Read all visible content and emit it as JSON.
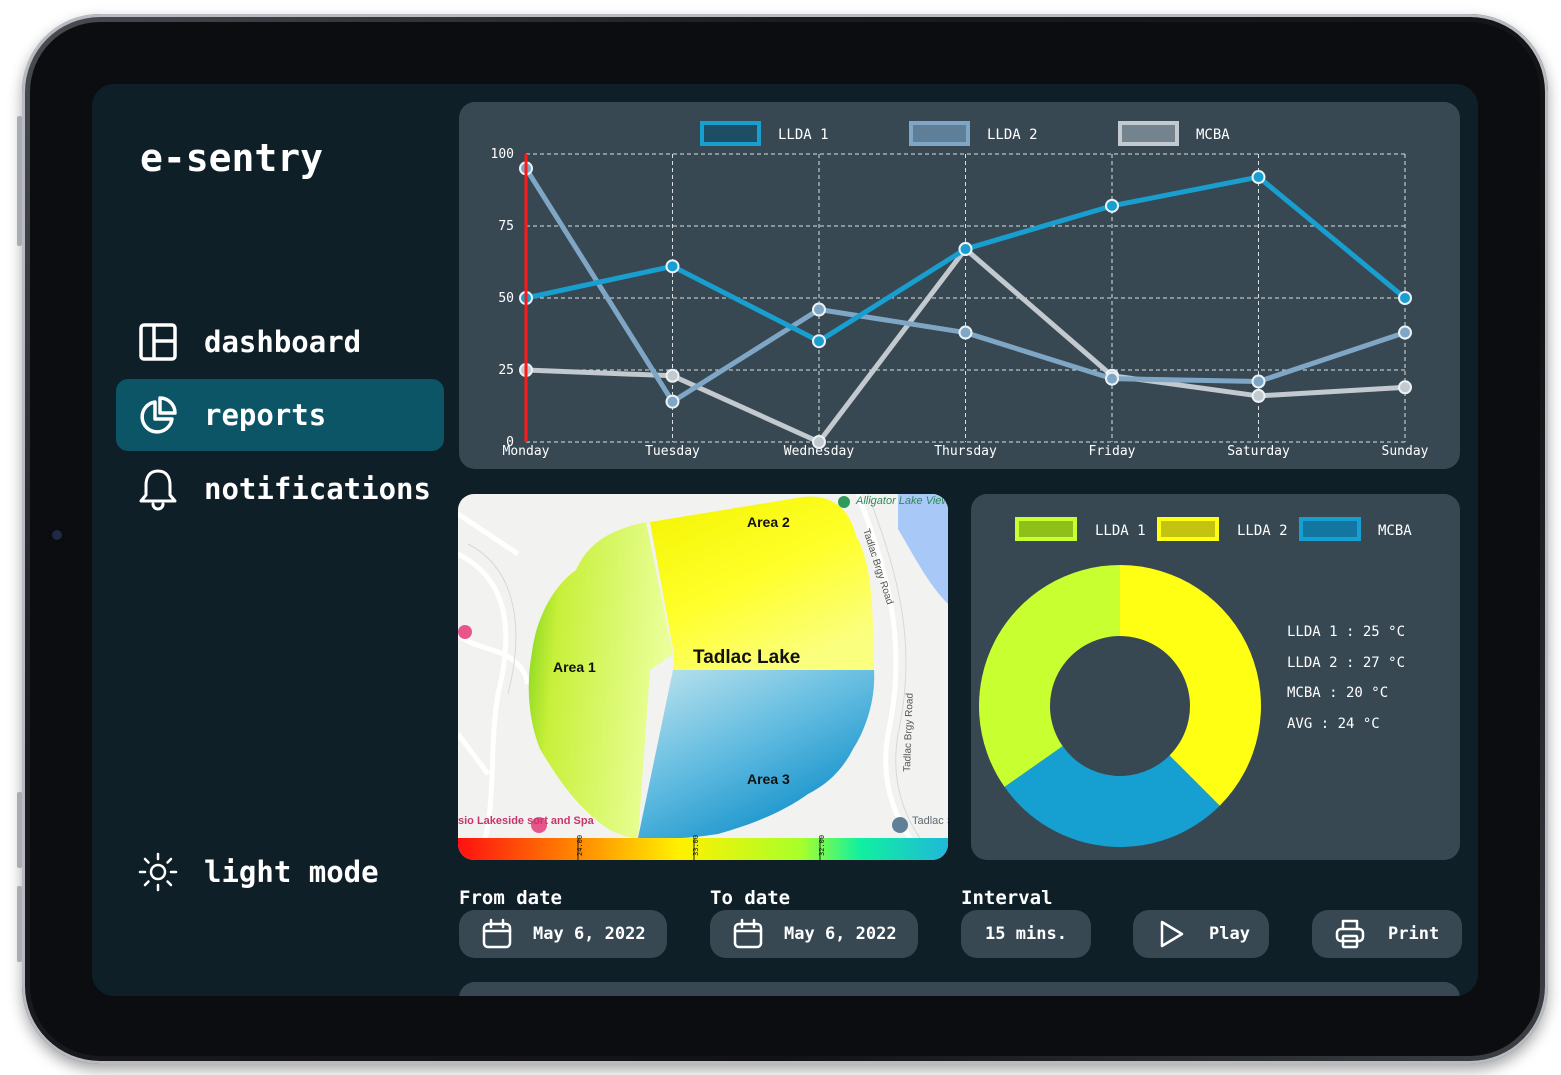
{
  "app": {
    "brand": "e-sentry"
  },
  "nav": {
    "items": [
      {
        "label": "dashboard",
        "icon": "layout-icon",
        "active": false
      },
      {
        "label": "reports",
        "icon": "pie-chart-icon",
        "active": true
      },
      {
        "label": "notifications",
        "icon": "bell-icon",
        "active": false
      }
    ],
    "theme_toggle": {
      "label": "light mode",
      "icon": "sun-icon"
    }
  },
  "colors": {
    "llda1": "#189fd0",
    "llda2": "#7fa7c5",
    "mcba": "#c2c9cf",
    "donut_llda1": "#c8ff30",
    "donut_llda2": "#ffff14",
    "donut_mcba": "#16a0d1",
    "cursor": "#ff1a1a",
    "active_nav": "#0b5566",
    "panel": "#374853",
    "background": "#0f1f28"
  },
  "chart_data": [
    {
      "type": "line",
      "x": [
        "Monday",
        "Tuesday",
        "Wednesday",
        "Thursday",
        "Friday",
        "Saturday",
        "Sunday"
      ],
      "ylim": [
        0,
        100
      ],
      "yticks": [
        "0",
        "25",
        "50",
        "75",
        "100"
      ],
      "grid": true,
      "legend_position": "top-center",
      "series": [
        {
          "name": "LLDA 1",
          "values": [
            50,
            61,
            35,
            67,
            82,
            92,
            50
          ]
        },
        {
          "name": "LLDA 2",
          "values": [
            95,
            14,
            46,
            38,
            22,
            21,
            38
          ]
        },
        {
          "name": "MCBA",
          "values": [
            25,
            23,
            0,
            67,
            23,
            16,
            19
          ]
        }
      ]
    },
    {
      "type": "pie",
      "legend_position": "top",
      "series": [
        {
          "name": "LLDA 1",
          "values": [
            25
          ]
        },
        {
          "name": "LLDA 2",
          "values": [
            27
          ]
        },
        {
          "name": "MCBA",
          "values": [
            20
          ]
        }
      ]
    }
  ],
  "stats": [
    "LLDA 1 : 25 °C",
    "LLDA 2 : 27 °C",
    "MCBA : 20 °C",
    "AVG : 24 °C"
  ],
  "map": {
    "lake_label": "Tadlac Lake",
    "areas": [
      "Area 1",
      "Area 2",
      "Area 3"
    ],
    "poi": [
      "Alligator Lake Viewing Deck",
      "sio Lakeside sort and Spa",
      "Tadlac School"
    ],
    "roads": [
      "Tadlac Brgy Road",
      "Tadlac Brgy Road"
    ],
    "scale_ticks": [
      "24.00",
      "33.00",
      "32.00"
    ]
  },
  "controls": {
    "from_date": {
      "label": "From date",
      "value": "May 6, 2022"
    },
    "to_date": {
      "label": "To date",
      "value": "May 6, 2022"
    },
    "interval": {
      "label": "Interval",
      "value": "15 mins."
    },
    "play_label": "Play",
    "print_label": "Print"
  }
}
